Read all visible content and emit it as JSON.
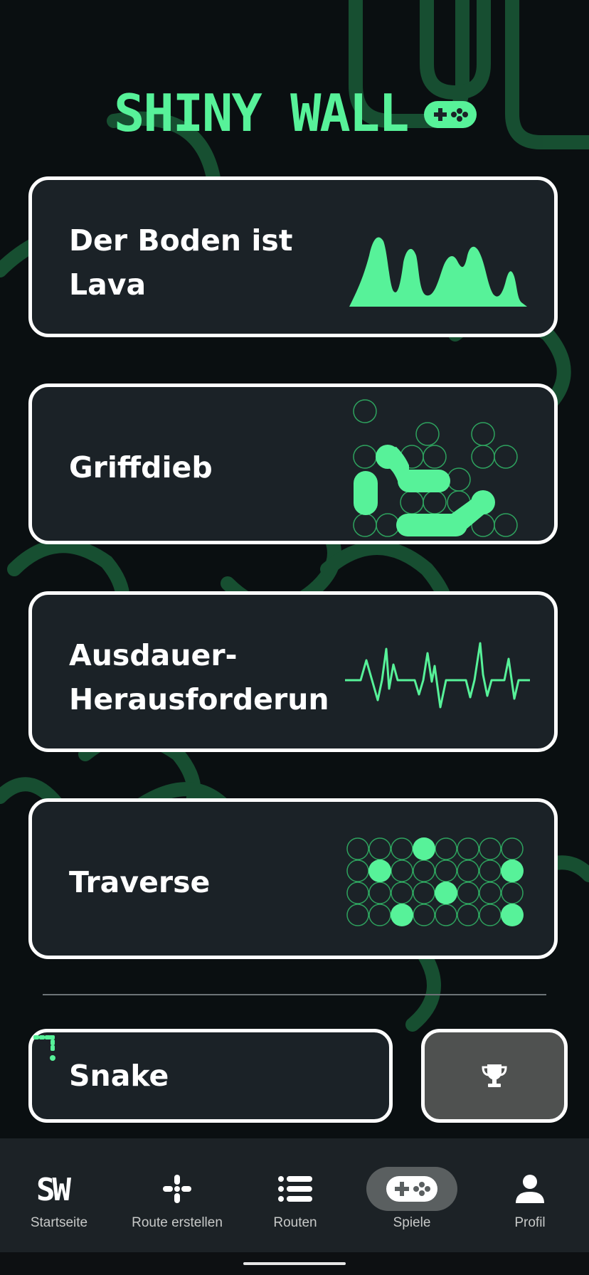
{
  "app": {
    "title": "SHINY WALL",
    "accent_color": "#57f299",
    "card_bg": "#1b2227"
  },
  "games": [
    {
      "title": "Der Boden ist\nLava",
      "icon": "lava-chart-icon"
    },
    {
      "title": "Griffdieb",
      "icon": "hold-thief-grid-icon"
    },
    {
      "title": "Ausdauer-\nHerausforderun",
      "icon": "heartbeat-icon"
    },
    {
      "title": "Traverse",
      "icon": "traverse-dots-icon"
    }
  ],
  "snake": {
    "title": "Snake",
    "icon": "snake-icon"
  },
  "leaderboard": {
    "icon": "trophy-icon"
  },
  "nav": {
    "items": [
      {
        "label": "Startseite",
        "icon": "sw-logo-icon",
        "active": false
      },
      {
        "label": "Route erstellen",
        "icon": "route-create-icon",
        "active": false
      },
      {
        "label": "Routen",
        "icon": "list-icon",
        "active": false
      },
      {
        "label": "Spiele",
        "icon": "gamepad-icon",
        "active": true
      },
      {
        "label": "Profil",
        "icon": "person-icon",
        "active": false
      }
    ]
  }
}
